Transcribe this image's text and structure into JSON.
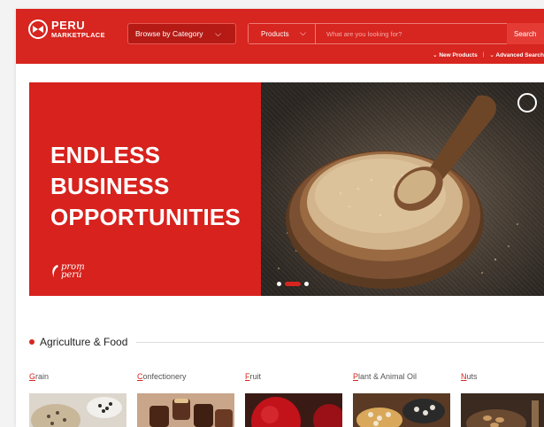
{
  "header": {
    "logo_line1": "PERU",
    "logo_line2": "MARKETPLACE",
    "browse_label": "Browse by Category",
    "search_category": "Products",
    "search_placeholder": "What are you looking for?",
    "search_button": "Search",
    "link_new_products": "⌄ New Products",
    "link_separator": "|",
    "link_advanced_search": "⌄ Advanced Search",
    "brand_color": "#d7251f"
  },
  "banner": {
    "headline_line1": "ENDLESS",
    "headline_line2": "BUSINESS",
    "headline_line3": "OPPORTUNITIES",
    "sponsor_line1": "prom",
    "sponsor_line2": "perú",
    "slide_count": 3,
    "active_slide": 2
  },
  "section": {
    "title": "Agriculture & Food",
    "categories": [
      {
        "first": "G",
        "rest": "rain"
      },
      {
        "first": "C",
        "rest": "onfectionery"
      },
      {
        "first": "F",
        "rest": "ruit"
      },
      {
        "first": "P",
        "rest": "lant & Animal Oil"
      },
      {
        "first": "N",
        "rest": "uts"
      }
    ]
  }
}
